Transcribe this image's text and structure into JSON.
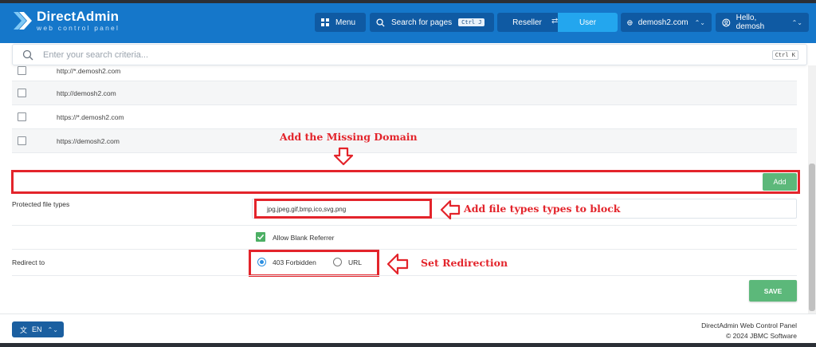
{
  "app": {
    "title": "DirectAdmin",
    "subtitle": "web control panel"
  },
  "header": {
    "menu_label": "Menu",
    "search_label": "Search for pages",
    "search_kbd": "Ctrl J",
    "reseller_label": "Reseller",
    "user_label": "User",
    "domain_label": "demosh2.com",
    "hello_label": "Hello, demosh"
  },
  "search": {
    "placeholder": "Enter your search criteria...",
    "kbd": "Ctrl K"
  },
  "url_rows": [
    {
      "label": "http://*.demosh2.com",
      "checked": false
    },
    {
      "label": "http://demosh2.com",
      "checked": false
    },
    {
      "label": "https://*.demosh2.com",
      "checked": false
    },
    {
      "label": "https://demosh2.com",
      "checked": false
    }
  ],
  "annotations": {
    "add_domain": "Add the Missing Domain",
    "file_types": "Add file types types to block",
    "redirection": "Set Redirection"
  },
  "form": {
    "add_button": "Add",
    "domain_input_value": "",
    "protected_label": "Protected file types",
    "protected_value": "jpg,jpeg,gif,bmp,ico,svg,png",
    "allow_blank_label": "Allow Blank Referrer",
    "allow_blank_checked": true,
    "redirect_label": "Redirect to",
    "redirect_options": [
      "403 Forbidden",
      "URL"
    ],
    "redirect_selected": "403 Forbidden",
    "save_button": "SAVE"
  },
  "footer": {
    "lang": "EN",
    "product": "DirectAdmin Web Control Panel",
    "copyright": "© 2024 JBMC Software"
  },
  "colors": {
    "header_bg": "#1577ca",
    "accent_blue": "#23a6ee",
    "annotation_red": "#e3242b",
    "success_green": "#5cb87a"
  }
}
